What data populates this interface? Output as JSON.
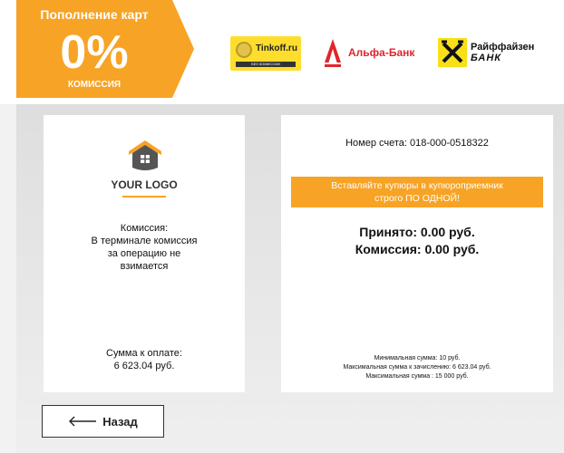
{
  "promo": {
    "title": "Пополнение карт",
    "big_value": "0%",
    "subtitle": "КОМИССИЯ",
    "color": "#f7a325"
  },
  "banks": {
    "tinkoff": {
      "name": "Tinkoff.ru",
      "strip": "БЕЗ КОМИССИИ",
      "color": "#ffdd2d"
    },
    "alfa": {
      "name": "Альфа-Банк",
      "color": "#e0262b"
    },
    "raif": {
      "name_line1": "Райффайзен",
      "name_line2": "БАНК",
      "color": "#f7e018"
    }
  },
  "left_panel": {
    "logo_text": "YOUR LOGO",
    "commission_title": "Комиссия:",
    "commission_line1": "В терминале комиссия",
    "commission_line2": "за операцию не",
    "commission_line3": "взимается",
    "amount_label": "Сумма к оплате:",
    "amount_value": "6 623.04 руб."
  },
  "right_panel": {
    "account": "Номер счета: 018-000-0518322",
    "insert_line1": "Вставляйте купюры в купюроприемник",
    "insert_line2": "строго ПО ОДНОЙ!",
    "accepted": "Принято: 0.00 руб.",
    "commission": "Комиссия: 0.00 руб.",
    "limit_min": "Минимальная сумма: 10 руб.",
    "limit_credit": "Максимальная сумма к зачислению: 6 623.04 руб.",
    "limit_max": "Максимальная сумма : 15 000 руб."
  },
  "back_button": {
    "label": "Назад",
    "icon": "arrow-left-icon"
  }
}
